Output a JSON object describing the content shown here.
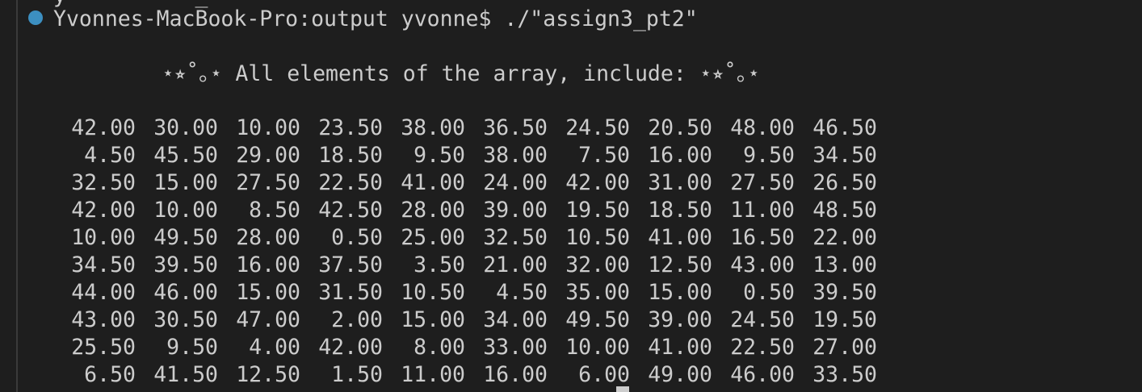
{
  "terminal": {
    "cut_line": "y          _",
    "prompt": "Yvonnes-MacBook-Pro:output yvonne$ ./\"assign3_pt2\"",
    "status_color": "#3c8fc1",
    "heading": "⋆⭒˚｡⋆ All elements of the array, include: ⋆⭒˚｡⋆",
    "rows": [
      [
        "42.00",
        "30.00",
        "10.00",
        "23.50",
        "38.00",
        "36.50",
        "24.50",
        "20.50",
        "48.00",
        "46.50"
      ],
      [
        "4.50",
        "45.50",
        "29.00",
        "18.50",
        "9.50",
        "38.00",
        "7.50",
        "16.00",
        "9.50",
        "34.50"
      ],
      [
        "32.50",
        "15.00",
        "27.50",
        "22.50",
        "41.00",
        "24.00",
        "42.00",
        "31.00",
        "27.50",
        "26.50"
      ],
      [
        "42.00",
        "10.00",
        "8.50",
        "42.50",
        "28.00",
        "39.00",
        "19.50",
        "18.50",
        "11.00",
        "48.50"
      ],
      [
        "10.00",
        "49.50",
        "28.00",
        "0.50",
        "25.00",
        "32.50",
        "10.50",
        "41.00",
        "16.50",
        "22.00"
      ],
      [
        "34.50",
        "39.50",
        "16.00",
        "37.50",
        "3.50",
        "21.00",
        "32.00",
        "12.50",
        "43.00",
        "13.00"
      ],
      [
        "44.00",
        "46.00",
        "15.00",
        "31.50",
        "10.50",
        "4.50",
        "35.00",
        "15.00",
        "0.50",
        "39.50"
      ],
      [
        "43.00",
        "30.50",
        "47.00",
        "2.00",
        "15.00",
        "34.00",
        "49.50",
        "39.00",
        "24.50",
        "19.50"
      ],
      [
        "25.50",
        "9.50",
        "4.00",
        "42.00",
        "8.00",
        "33.00",
        "10.00",
        "41.00",
        "22.50",
        "27.00"
      ],
      [
        "6.50",
        "41.50",
        "12.50",
        "1.50",
        "11.00",
        "16.00",
        "6.00",
        "49.00",
        "46.00",
        "33.50"
      ]
    ]
  }
}
